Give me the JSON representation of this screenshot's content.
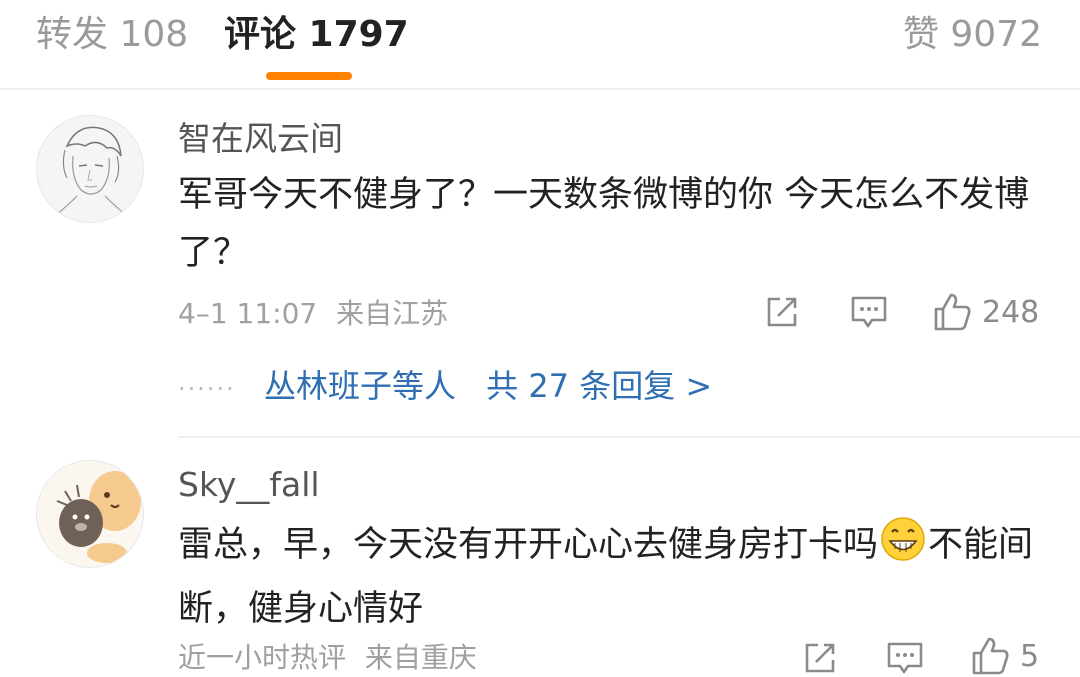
{
  "tabs": {
    "repost": "转发 108",
    "comments": "评论 1797",
    "likes": "赞 9072"
  },
  "comments": [
    {
      "username": "智在风云间",
      "text": "军哥今天不健身了？一天数条微博的你 今天怎么不发博了？",
      "time": "4–1 11:07",
      "location": "来自江苏",
      "like_count": "248",
      "replies": {
        "dots": "······",
        "users": "丛林班子等人",
        "count": "共 27 条回复 >"
      }
    },
    {
      "username": "Sky__fall",
      "text_before_emoji": "雷总，早，今天没有开开心心去健身房打卡吗",
      "emoji": "grinning-emoji",
      "text_after_emoji": "不能间断，健身心情好",
      "time": "近一小时热评",
      "location": "来自重庆",
      "like_count": "5"
    }
  ],
  "colors": {
    "accent": "#ff8200",
    "link": "#2f6fb2",
    "muted": "#a0a0a0"
  }
}
